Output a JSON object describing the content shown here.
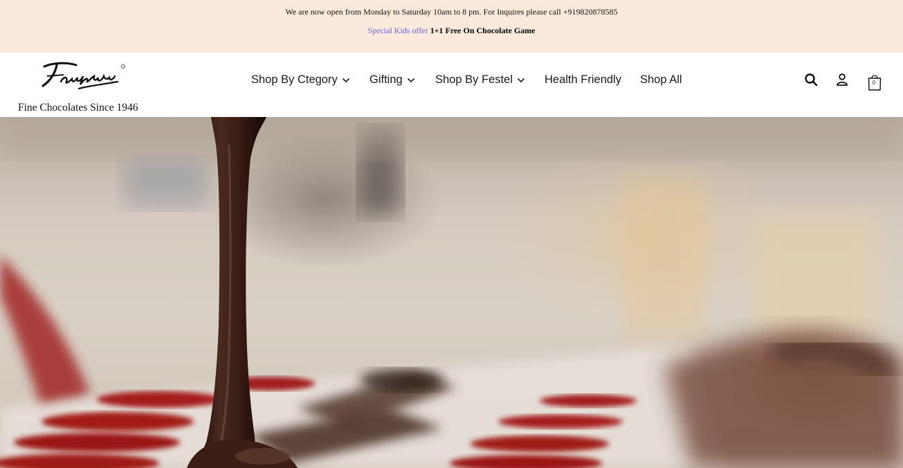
{
  "announcement": {
    "hours_text": "We are now open from Monday to Saturday 10am to 8 pm. For Inquires please call +919820878585",
    "offer_link": "Special Kids offer",
    "offer_text": "1+1 Free On Chocolate Game"
  },
  "brand": {
    "logo_text": "Fantasie",
    "tagline": "Fine Chocolates Since 1946"
  },
  "nav": {
    "items": [
      {
        "label": "Shop By Ctegory",
        "has_dropdown": true
      },
      {
        "label": "Gifting",
        "has_dropdown": true
      },
      {
        "label": "Shop By Festel",
        "has_dropdown": true
      },
      {
        "label": "Health Friendly",
        "has_dropdown": false
      },
      {
        "label": "Shop All",
        "has_dropdown": false
      }
    ]
  },
  "header_icons": {
    "search": "search-icon",
    "account": "user-icon",
    "cart": "shopping-bag-icon",
    "cart_count": "0"
  },
  "hero": {
    "image": "chocolate-pouring-into-molds"
  },
  "colors": {
    "announcement_bg": "#fbeadb",
    "offer_link": "#6b5cf0",
    "chocolate": "#3b1f16",
    "mold_red": "#9e1f1c"
  }
}
